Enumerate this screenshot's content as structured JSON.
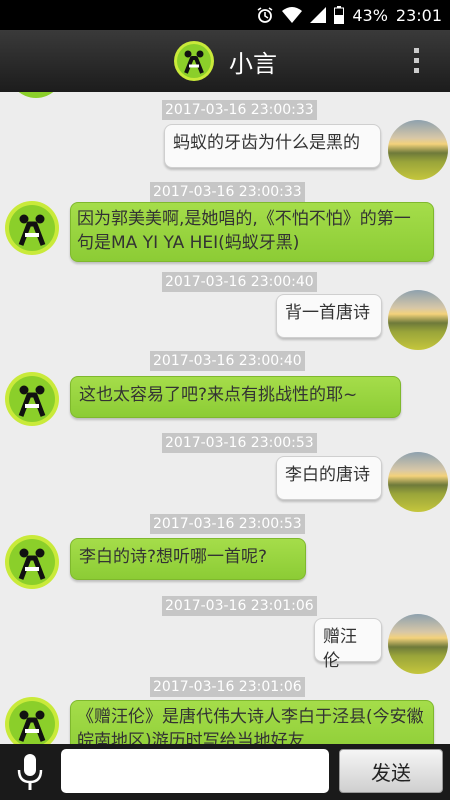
{
  "status": {
    "battery": "43%",
    "time": "23:01"
  },
  "header": {
    "title": "小言"
  },
  "messages": [
    {
      "from": "user",
      "time": "2017-03-16 23:00:33",
      "text": "蚂蚁的牙齿为什么是黑的"
    },
    {
      "from": "bot",
      "time": "2017-03-16 23:00:33",
      "text": "因为郭美美啊,是她唱的,《不怕不怕》的第一句是MA YI YA HEI(蚂蚁牙黑)"
    },
    {
      "from": "user",
      "time": "2017-03-16 23:00:40",
      "text": "背一首唐诗"
    },
    {
      "from": "bot",
      "time": "2017-03-16 23:00:40",
      "text": "这也太容易了吧?来点有挑战性的耶~"
    },
    {
      "from": "user",
      "time": "2017-03-16 23:00:53",
      "text": "李白的唐诗"
    },
    {
      "from": "bot",
      "time": "2017-03-16 23:00:53",
      "text": "李白的诗?想听哪一首呢?"
    },
    {
      "from": "user",
      "time": "2017-03-16 23:01:06",
      "text": "赠汪伦"
    },
    {
      "from": "bot",
      "time": "2017-03-16 23:01:06",
      "text": "《赠汪伦》是唐代伟大诗人李白于泾县(今安徽皖南地区)游历时写给当地好友"
    }
  ],
  "input": {
    "placeholder": "",
    "send_label": "发送"
  }
}
